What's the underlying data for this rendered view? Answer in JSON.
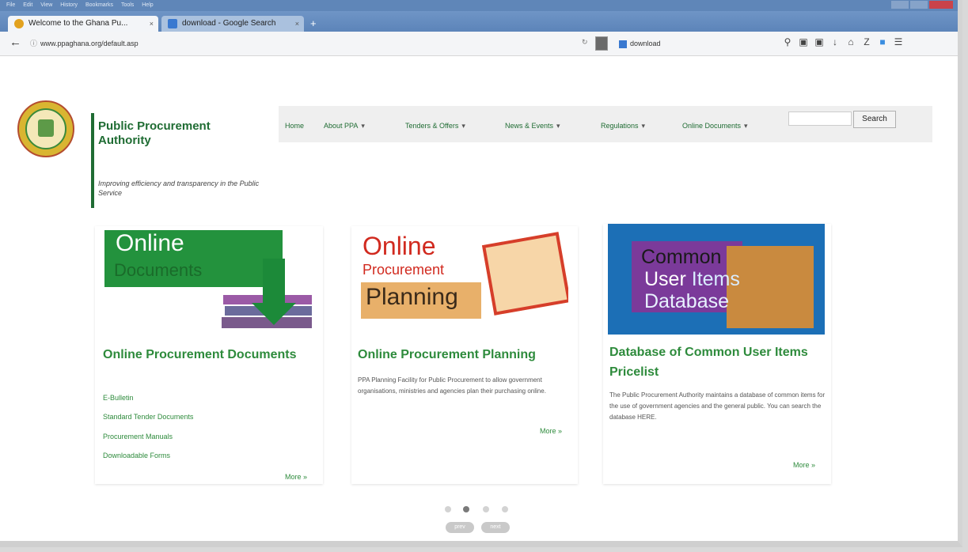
{
  "browser": {
    "menu": [
      "File",
      "Edit",
      "View",
      "History",
      "Bookmarks",
      "Tools",
      "Help"
    ],
    "tabs": [
      {
        "label": "Welcome to the Ghana Pu...",
        "close": "×"
      },
      {
        "label": "download - Google Search",
        "close": "×"
      }
    ],
    "new_tab": "+",
    "url": "www.ppaghana.org/default.asp",
    "search_value": "download",
    "colors": {
      "titlebar": "#5f86b8",
      "close": "#c9434a"
    }
  },
  "site": {
    "org_name": "Public Procurement Authority",
    "tagline": "Improving efficiency and transparency in the Public Service",
    "nav": [
      {
        "label": "Home",
        "dropdown": false
      },
      {
        "label": "About PPA",
        "dropdown": true
      },
      {
        "label": "Tenders & Offers",
        "dropdown": true
      },
      {
        "label": "News & Events",
        "dropdown": true
      },
      {
        "label": "Regulations",
        "dropdown": true
      },
      {
        "label": "Online Documents",
        "dropdown": true
      }
    ],
    "search_button": "Search",
    "accent": "#2e8b3c"
  },
  "cards": [
    {
      "banner_line1": "Online",
      "banner_line2": "Documents",
      "title": "Online Procurement Documents",
      "links": [
        "E-Bulletin",
        "Standard Tender Documents",
        "Procurement Manuals",
        "Downloadable Forms"
      ],
      "more": "More »"
    },
    {
      "banner_line1": "Online",
      "banner_line2": "Procurement",
      "banner_line3": "Planning",
      "title": "Online Procurement Planning",
      "text": "PPA Planning Facility for Public Procurement to allow government organisations, ministries and agencies plan their purchasing online.",
      "more": "More »"
    },
    {
      "banner_line1": "Common",
      "banner_line2a": "User",
      "banner_line2b": "Items",
      "banner_line3": "Database",
      "title": "Database of Common User Items Pricelist",
      "text": "The Public Procurement Authority maintains a database of common items for the use of government agencies and the general public. You can search the database HERE.",
      "more": "More »"
    }
  ],
  "pager": {
    "dots": 4,
    "active_index": 1,
    "prev": "prev",
    "next": "next"
  }
}
